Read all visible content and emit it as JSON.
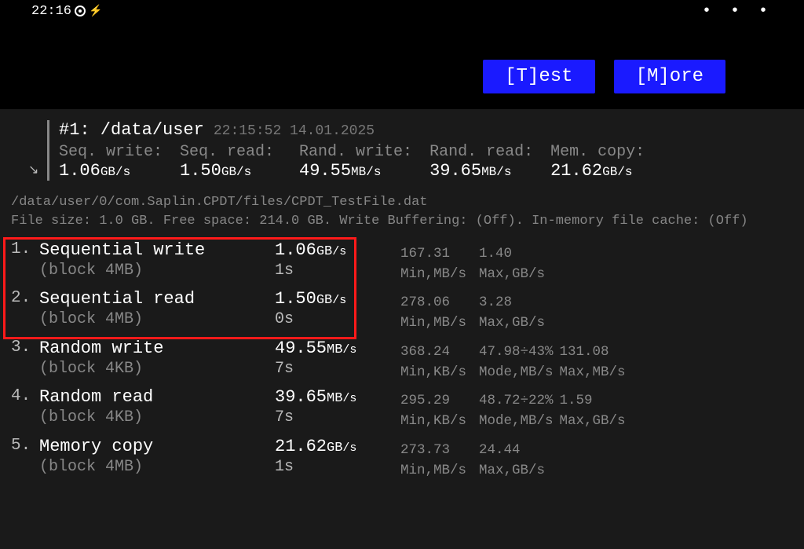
{
  "statusbar": {
    "time": "22:16",
    "more": "• • •"
  },
  "buttons": {
    "test": "[T]est",
    "more": "[M]ore"
  },
  "summary": {
    "title": "#1: /data/user",
    "timestamp": "22:15:52 14.01.2025",
    "cols": [
      {
        "label": "Seq. write:",
        "value": "1.06",
        "unit": "GB/s"
      },
      {
        "label": "Seq. read:",
        "value": "1.50",
        "unit": "GB/s"
      },
      {
        "label": "Rand. write:",
        "value": "49.55",
        "unit": "MB/s"
      },
      {
        "label": "Rand. read:",
        "value": "39.65",
        "unit": "MB/s"
      },
      {
        "label": "Mem. copy:",
        "value": "21.62",
        "unit": "GB/s"
      }
    ]
  },
  "meta": {
    "line1": "/data/user/0/com.Saplin.CPDT/files/CPDT_TestFile.dat",
    "line2": "File size: 1.0 GB. Free space: 214.0 GB. Write Buffering: (Off). In-memory file cache: (Off)"
  },
  "tests": [
    {
      "num": "1.",
      "name": "Sequential write",
      "block": "(block 4MB)",
      "value": "1.06",
      "unit1": "GB",
      "unit2": "/s",
      "duration": "1s",
      "stats": {
        "vals": [
          "167.31",
          "1.40"
        ],
        "labels": [
          "Min,MB/s",
          "Max,GB/s"
        ]
      }
    },
    {
      "num": "2.",
      "name": "Sequential read",
      "block": "(block 4MB)",
      "value": "1.50",
      "unit1": "GB",
      "unit2": "/s",
      "duration": "0s",
      "stats": {
        "vals": [
          "278.06",
          "3.28"
        ],
        "labels": [
          "Min,MB/s",
          "Max,GB/s"
        ]
      }
    },
    {
      "num": "3.",
      "name": "Random write",
      "block": "(block 4KB)",
      "value": "49.55",
      "unit1": "MB",
      "unit2": "/s",
      "duration": "7s",
      "stats": {
        "vals": [
          "368.24",
          "47.98÷43%",
          "131.08"
        ],
        "labels": [
          "Min,KB/s",
          "Mode,MB/s",
          "Max,MB/s"
        ]
      }
    },
    {
      "num": "4.",
      "name": "Random read",
      "block": "(block 4KB)",
      "value": "39.65",
      "unit1": "MB",
      "unit2": "/s",
      "duration": "7s",
      "stats": {
        "vals": [
          "295.29",
          "48.72÷22%",
          "1.59"
        ],
        "labels": [
          "Min,KB/s",
          "Mode,MB/s",
          "Max,GB/s"
        ]
      }
    },
    {
      "num": "5.",
      "name": "Memory copy",
      "block": "(block 4MB)",
      "value": "21.62",
      "unit1": "GB",
      "unit2": "/s",
      "duration": "1s",
      "stats": {
        "vals": [
          "273.73",
          "24.44"
        ],
        "labels": [
          "Min,MB/s",
          "Max,GB/s"
        ]
      }
    }
  ]
}
